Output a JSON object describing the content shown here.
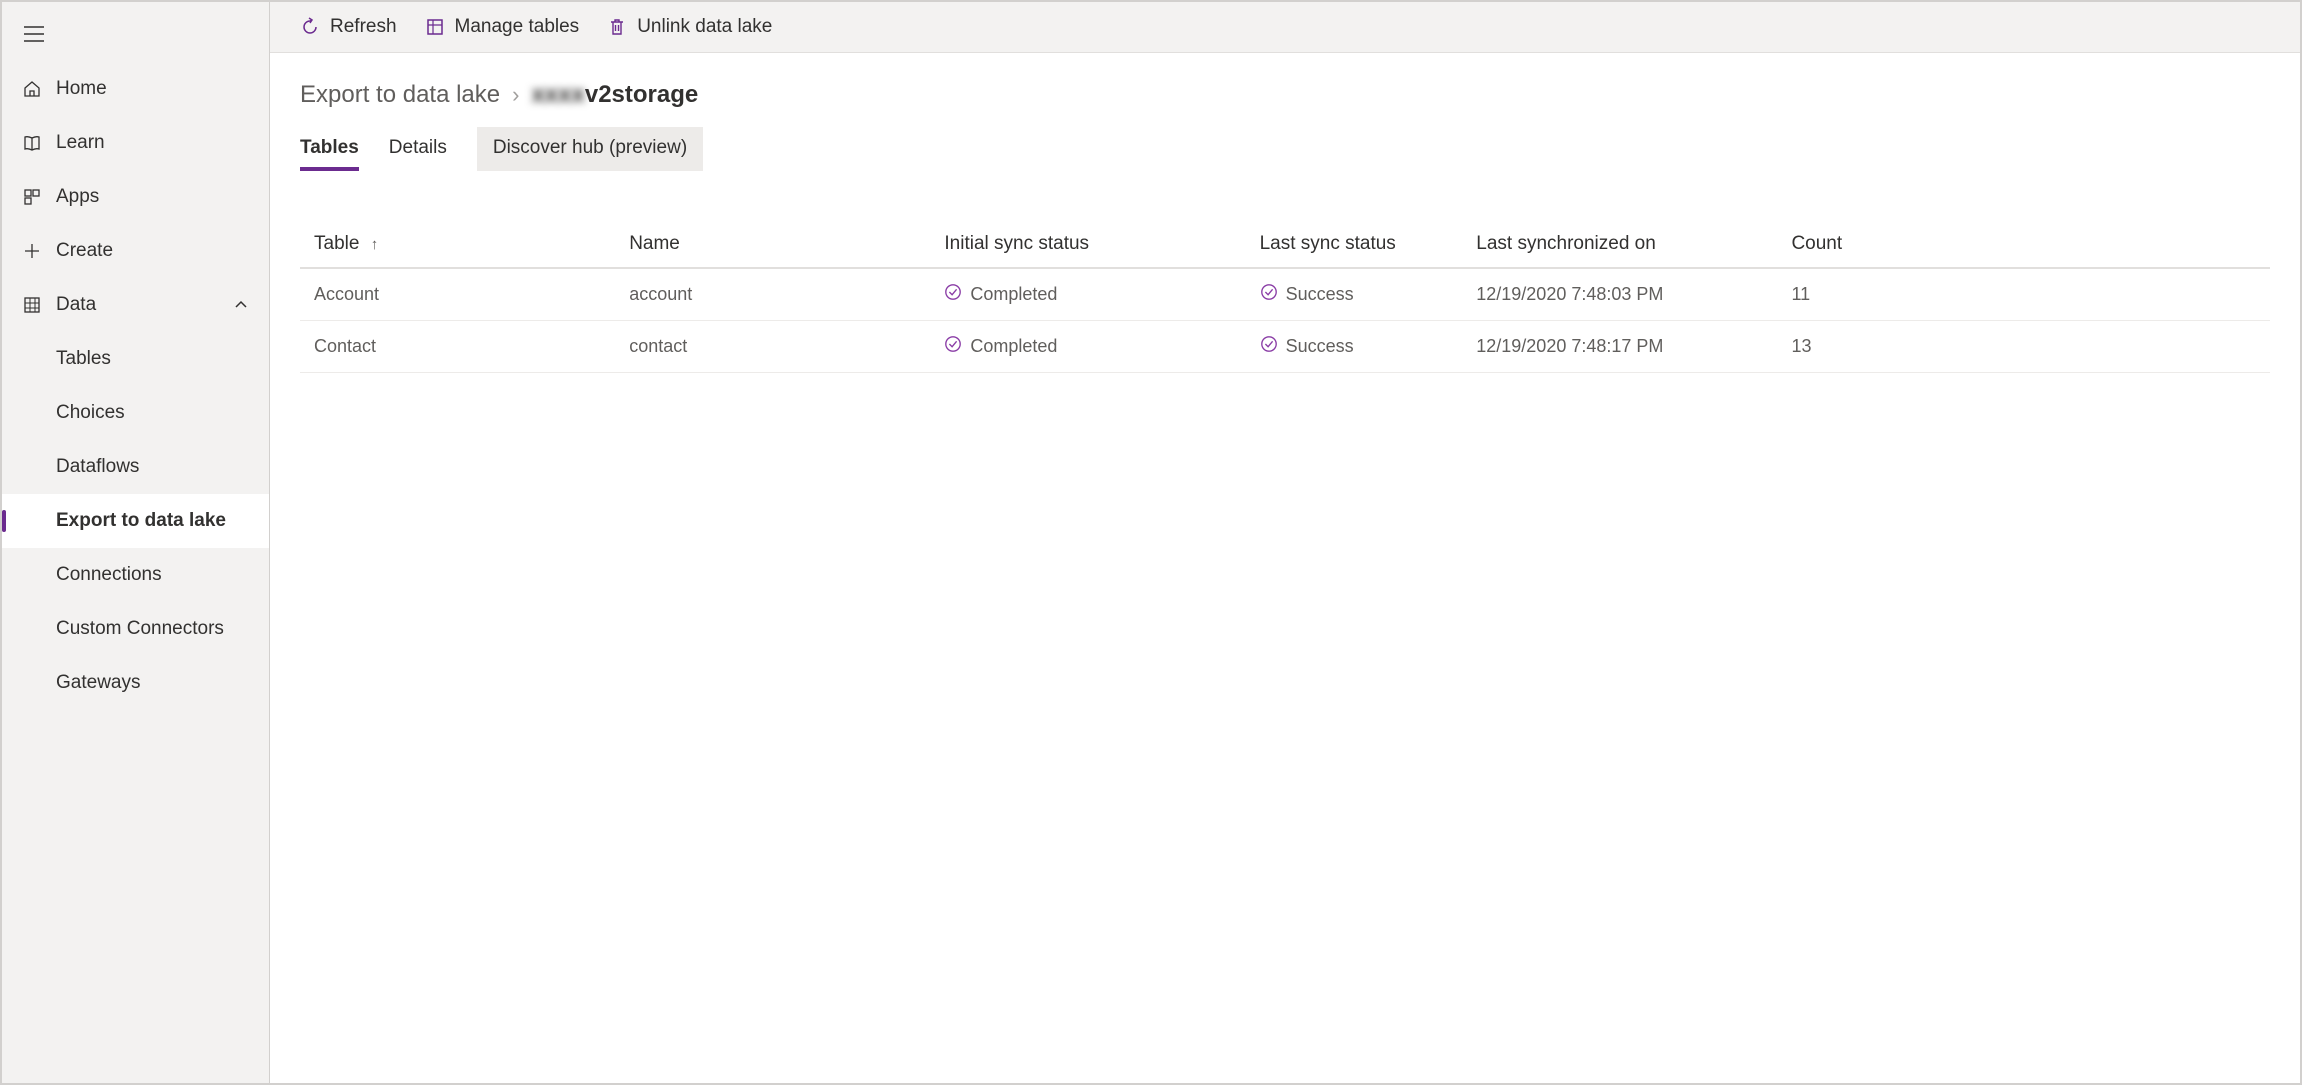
{
  "sidebar": {
    "items": [
      {
        "label": "Home"
      },
      {
        "label": "Learn"
      },
      {
        "label": "Apps"
      },
      {
        "label": "Create"
      },
      {
        "label": "Data",
        "expanded": true
      }
    ],
    "dataSubItems": [
      {
        "label": "Tables"
      },
      {
        "label": "Choices"
      },
      {
        "label": "Dataflows"
      },
      {
        "label": "Export to data lake",
        "active": true
      },
      {
        "label": "Connections"
      },
      {
        "label": "Custom Connectors"
      },
      {
        "label": "Gateways"
      }
    ]
  },
  "toolbar": {
    "refresh": "Refresh",
    "manage": "Manage tables",
    "unlink": "Unlink data lake"
  },
  "breadcrumb": {
    "parent": "Export to data lake",
    "current_blurred": "xxxx",
    "current_rest": "v2storage"
  },
  "tabs": [
    {
      "label": "Tables",
      "active": true
    },
    {
      "label": "Details"
    },
    {
      "label": "Discover hub (preview)",
      "highlight": true
    }
  ],
  "table": {
    "headers": {
      "table": "Table",
      "name": "Name",
      "initial": "Initial sync status",
      "last": "Last sync status",
      "synced": "Last synchronized on",
      "count": "Count"
    },
    "rows": [
      {
        "table": "Account",
        "name": "account",
        "initial": "Completed",
        "last": "Success",
        "synced": "12/19/2020 7:48:03 PM",
        "count": "11"
      },
      {
        "table": "Contact",
        "name": "contact",
        "initial": "Completed",
        "last": "Success",
        "synced": "12/19/2020 7:48:17 PM",
        "count": "13"
      }
    ]
  }
}
